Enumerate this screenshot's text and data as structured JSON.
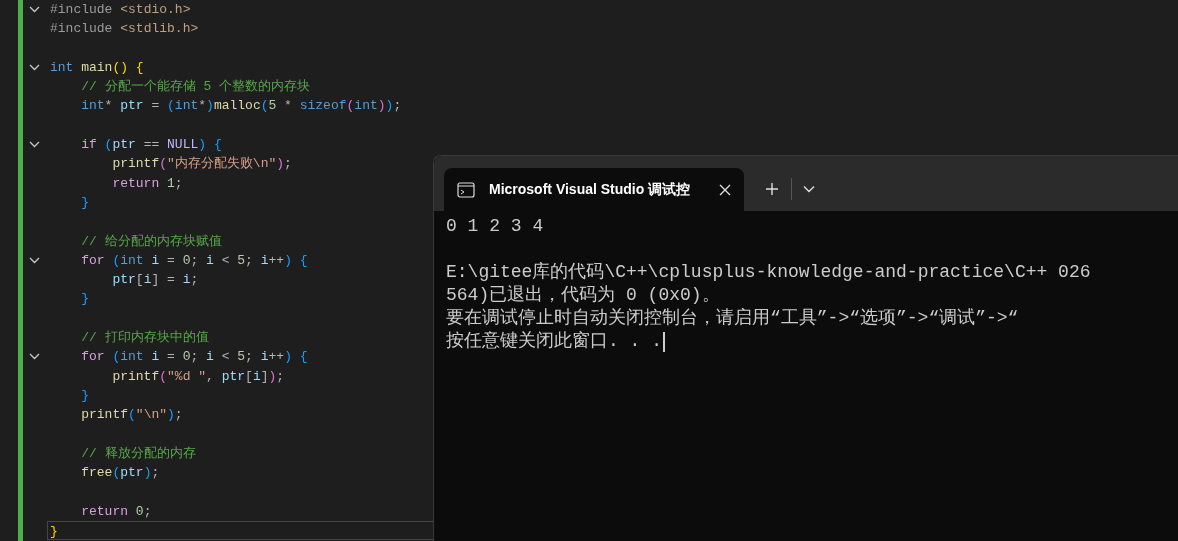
{
  "editor": {
    "lines": [
      {
        "foldable": true,
        "tokens": [
          {
            "text": "#include",
            "kind": "preproc"
          },
          {
            "text": " <stdio.h>",
            "kind": "header"
          }
        ]
      },
      {
        "foldable": false,
        "tokens": [
          {
            "text": "#include",
            "kind": "preproc"
          },
          {
            "text": " <stdlib.h>",
            "kind": "header"
          }
        ]
      },
      {
        "foldable": false
      },
      {
        "foldable": true,
        "tokens": [
          {
            "text": "int",
            "kind": "type"
          },
          {
            "text": " main",
            "kind": "func"
          },
          {
            "text": "()",
            "kind": "bracket1"
          },
          {
            "text": " {",
            "kind": "bracket1"
          }
        ]
      },
      {
        "foldable": false,
        "tokens": [
          {
            "text": "    // 分配一个能存储 5 个整数的内存块",
            "kind": "comment"
          }
        ]
      },
      {
        "foldable": false,
        "tokens": [
          {
            "text": "    int",
            "kind": "type"
          },
          {
            "text": "* ",
            "kind": "punct"
          },
          {
            "text": "ptr",
            "kind": "var"
          },
          {
            "text": " = ",
            "kind": "punct"
          },
          {
            "text": "(",
            "kind": "bracket3"
          },
          {
            "text": "int",
            "kind": "type"
          },
          {
            "text": "*",
            "kind": "punct"
          },
          {
            "text": ")",
            "kind": "bracket3"
          },
          {
            "text": "malloc",
            "kind": "func"
          },
          {
            "text": "(",
            "kind": "bracket3"
          },
          {
            "text": "5",
            "kind": "number"
          },
          {
            "text": " * ",
            "kind": "punct"
          },
          {
            "text": "sizeof",
            "kind": "type"
          },
          {
            "text": "(",
            "kind": "bracket2"
          },
          {
            "text": "int",
            "kind": "type"
          },
          {
            "text": ")",
            "kind": "bracket2"
          },
          {
            "text": ")",
            "kind": "bracket3"
          },
          {
            "text": ";",
            "kind": "punct"
          }
        ]
      },
      {
        "foldable": false
      },
      {
        "foldable": true,
        "tokens": [
          {
            "text": "    if",
            "kind": "keyword"
          },
          {
            "text": " (",
            "kind": "bracket3"
          },
          {
            "text": "ptr",
            "kind": "var"
          },
          {
            "text": " == ",
            "kind": "punct"
          },
          {
            "text": "NULL",
            "kind": "macro"
          },
          {
            "text": ")",
            "kind": "bracket3"
          },
          {
            "text": " {",
            "kind": "bracket3"
          }
        ]
      },
      {
        "foldable": false,
        "tokens": [
          {
            "text": "        printf",
            "kind": "func"
          },
          {
            "text": "(",
            "kind": "bracket2"
          },
          {
            "text": "\"内存分配失败\\n\"",
            "kind": "string"
          },
          {
            "text": ")",
            "kind": "bracket2"
          },
          {
            "text": ";",
            "kind": "punct"
          }
        ]
      },
      {
        "foldable": false,
        "tokens": [
          {
            "text": "        return",
            "kind": "keyword"
          },
          {
            "text": " 1",
            "kind": "number"
          },
          {
            "text": ";",
            "kind": "punct"
          }
        ]
      },
      {
        "foldable": false,
        "tokens": [
          {
            "text": "    }",
            "kind": "bracket3"
          }
        ]
      },
      {
        "foldable": false
      },
      {
        "foldable": false,
        "tokens": [
          {
            "text": "    // 给分配的内存块赋值",
            "kind": "comment"
          }
        ]
      },
      {
        "foldable": true,
        "tokens": [
          {
            "text": "    for",
            "kind": "keyword"
          },
          {
            "text": " (",
            "kind": "bracket3"
          },
          {
            "text": "int",
            "kind": "type"
          },
          {
            "text": " i",
            "kind": "var"
          },
          {
            "text": " = ",
            "kind": "punct"
          },
          {
            "text": "0",
            "kind": "number"
          },
          {
            "text": "; ",
            "kind": "punct"
          },
          {
            "text": "i",
            "kind": "var"
          },
          {
            "text": " < ",
            "kind": "punct"
          },
          {
            "text": "5",
            "kind": "number"
          },
          {
            "text": "; ",
            "kind": "punct"
          },
          {
            "text": "i",
            "kind": "var"
          },
          {
            "text": "++",
            "kind": "punct"
          },
          {
            "text": ")",
            "kind": "bracket3"
          },
          {
            "text": " {",
            "kind": "bracket3"
          }
        ]
      },
      {
        "foldable": false,
        "tokens": [
          {
            "text": "        ptr",
            "kind": "var"
          },
          {
            "text": "[",
            "kind": "punct"
          },
          {
            "text": "i",
            "kind": "var"
          },
          {
            "text": "]",
            "kind": "punct"
          },
          {
            "text": " = ",
            "kind": "punct"
          },
          {
            "text": "i",
            "kind": "var"
          },
          {
            "text": ";",
            "kind": "punct"
          }
        ]
      },
      {
        "foldable": false,
        "tokens": [
          {
            "text": "    }",
            "kind": "bracket3"
          }
        ]
      },
      {
        "foldable": false
      },
      {
        "foldable": false,
        "tokens": [
          {
            "text": "    // 打印内存块中的值",
            "kind": "comment"
          }
        ]
      },
      {
        "foldable": true,
        "tokens": [
          {
            "text": "    for",
            "kind": "keyword"
          },
          {
            "text": " (",
            "kind": "bracket3"
          },
          {
            "text": "int",
            "kind": "type"
          },
          {
            "text": " i",
            "kind": "var"
          },
          {
            "text": " = ",
            "kind": "punct"
          },
          {
            "text": "0",
            "kind": "number"
          },
          {
            "text": "; ",
            "kind": "punct"
          },
          {
            "text": "i",
            "kind": "var"
          },
          {
            "text": " < ",
            "kind": "punct"
          },
          {
            "text": "5",
            "kind": "number"
          },
          {
            "text": "; ",
            "kind": "punct"
          },
          {
            "text": "i",
            "kind": "var"
          },
          {
            "text": "++",
            "kind": "punct"
          },
          {
            "text": ")",
            "kind": "bracket3"
          },
          {
            "text": " {",
            "kind": "bracket3"
          }
        ]
      },
      {
        "foldable": false,
        "tokens": [
          {
            "text": "        printf",
            "kind": "func"
          },
          {
            "text": "(",
            "kind": "bracket2"
          },
          {
            "text": "\"%d \"",
            "kind": "string"
          },
          {
            "text": ", ",
            "kind": "punct"
          },
          {
            "text": "ptr",
            "kind": "var"
          },
          {
            "text": "[",
            "kind": "punct"
          },
          {
            "text": "i",
            "kind": "var"
          },
          {
            "text": "]",
            "kind": "punct"
          },
          {
            "text": ")",
            "kind": "bracket2"
          },
          {
            "text": ";",
            "kind": "punct"
          }
        ]
      },
      {
        "foldable": false,
        "tokens": [
          {
            "text": "    }",
            "kind": "bracket3"
          }
        ]
      },
      {
        "foldable": false,
        "tokens": [
          {
            "text": "    printf",
            "kind": "func"
          },
          {
            "text": "(",
            "kind": "bracket3"
          },
          {
            "text": "\"\\n\"",
            "kind": "string"
          },
          {
            "text": ")",
            "kind": "bracket3"
          },
          {
            "text": ";",
            "kind": "punct"
          }
        ]
      },
      {
        "foldable": false
      },
      {
        "foldable": false,
        "tokens": [
          {
            "text": "    // 释放分配的内存",
            "kind": "comment"
          }
        ]
      },
      {
        "foldable": false,
        "tokens": [
          {
            "text": "    free",
            "kind": "func"
          },
          {
            "text": "(",
            "kind": "bracket3"
          },
          {
            "text": "ptr",
            "kind": "var"
          },
          {
            "text": ")",
            "kind": "bracket3"
          },
          {
            "text": ";",
            "kind": "punct"
          }
        ]
      },
      {
        "foldable": false
      },
      {
        "foldable": false,
        "tokens": [
          {
            "text": "    return",
            "kind": "keyword"
          },
          {
            "text": " 0",
            "kind": "number"
          },
          {
            "text": ";",
            "kind": "punct"
          }
        ]
      },
      {
        "foldable": false,
        "current": true,
        "tokens": [
          {
            "text": "}",
            "kind": "bracket1"
          }
        ]
      }
    ]
  },
  "console": {
    "tab": {
      "title": "Microsoft Visual Studio 调试控",
      "selected": true
    },
    "blocks": [
      [
        "0 1 2 3 4"
      ],
      [
        "E:\\gitee库的代码\\C++\\cplusplus-knowledge-and-practice\\C++ 026",
        "564)已退出，代码为 0 (0x0)。",
        "要在调试停止时自动关闭控制台，请启用“工具”->“选项”->“调试”->“",
        "按任意键关闭此窗口. . ."
      ]
    ],
    "cursor_visible": true
  }
}
